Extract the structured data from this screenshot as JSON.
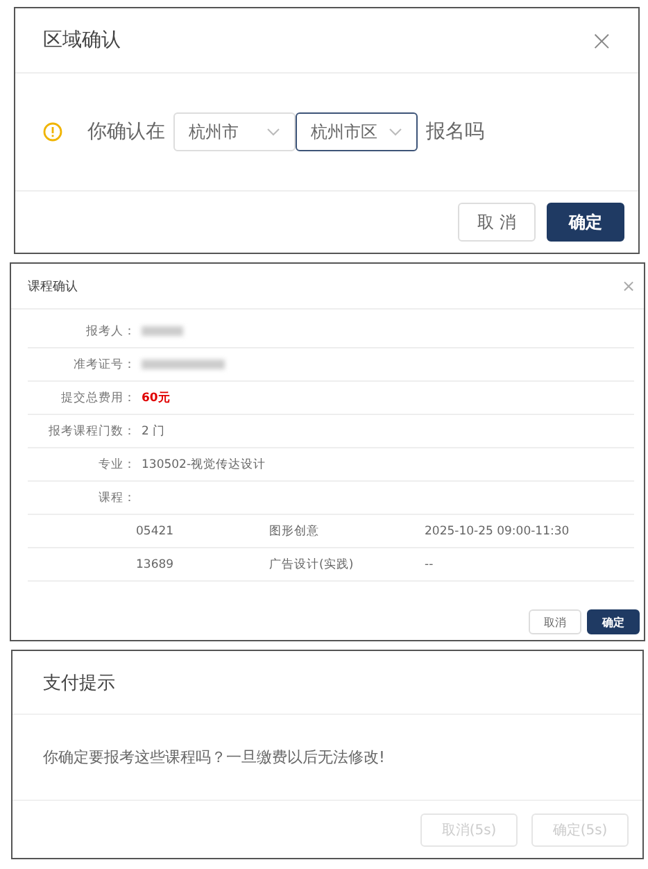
{
  "region_dialog": {
    "title": "区域确认",
    "close": "×",
    "prompt_before": "你确认在",
    "selects": [
      {
        "value": "杭州市",
        "focused": false
      },
      {
        "value": "杭州市区",
        "focused": true
      }
    ],
    "prompt_after": "报名吗",
    "buttons": [
      {
        "label": "取 消",
        "kind": "secondary"
      },
      {
        "label": "确定",
        "kind": "primary"
      }
    ]
  },
  "course_dialog": {
    "title": "课程确认",
    "close": "×",
    "fields": [
      {
        "label": "报考人：",
        "redacted": true
      },
      {
        "label": "准考证号：",
        "redacted": true
      },
      {
        "label": "提交总费用：",
        "value": "60元",
        "emphasis": true
      },
      {
        "label": "报考课程门数：",
        "value": "2 门",
        "emphasis": false
      },
      {
        "label": "专业：",
        "value": "130502-视觉传达设计",
        "emphasis": false
      },
      {
        "label": "课程："
      }
    ],
    "courses": [
      {
        "code": "05421",
        "name": "图形创意",
        "time": "2025-10-25 09:00-11:30"
      },
      {
        "code": "13689",
        "name": "广告设计(实践)",
        "time": "--"
      }
    ],
    "buttons": [
      {
        "label": "取消",
        "kind": "secondary"
      },
      {
        "label": "确定",
        "kind": "primary"
      }
    ]
  },
  "pay_dialog": {
    "title": "支付提示",
    "message": "你确定要报考这些课程吗？一旦缴费以后无法修改!",
    "buttons": [
      {
        "label": "取消(5s)",
        "disabled": true
      },
      {
        "label": "确定(5s)",
        "disabled": true
      }
    ]
  }
}
